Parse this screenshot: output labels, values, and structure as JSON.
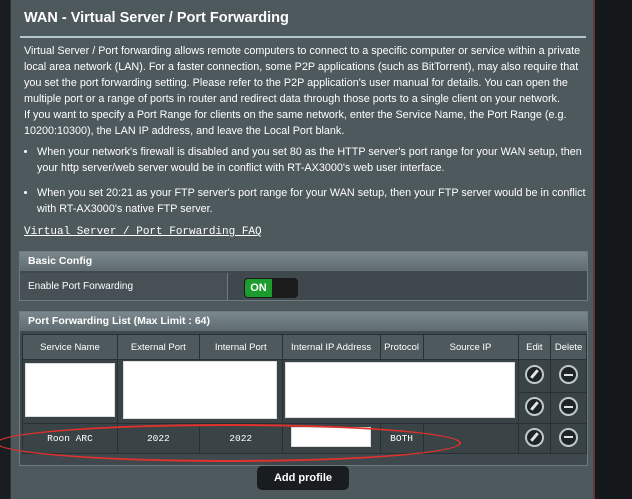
{
  "page": {
    "title": "WAN - Virtual Server / Port Forwarding",
    "description_1": "Virtual Server / Port forwarding allows remote computers to connect to a specific computer or service within a private local area network (LAN). For a faster connection, some P2P applications (such as BitTorrent), may also require that you set the port forwarding setting. Please refer to the P2P application's user manual for details. You can open the multiple port or a range of ports in router and redirect data through those ports to a single client on your network.",
    "description_2": "If you want to specify a Port Range for clients on the same network, enter the Service Name, the Port Range (e.g. 10200:10300), the LAN IP address, and leave the Local Port blank.",
    "bullet_1": "When your network's firewall is disabled and you set 80 as the HTTP server's port range for your WAN setup, then your http server/web server would be in conflict with RT-AX3000's web user interface.",
    "bullet_2": "When you set 20:21 as your FTP server's port range for your WAN setup, then your FTP server would be in conflict with RT-AX3000's native FTP server.",
    "faq_link": "Virtual Server / Port Forwarding FAQ"
  },
  "basic_config": {
    "header": "Basic Config",
    "enable_label": "Enable Port Forwarding",
    "toggle_state": "ON"
  },
  "port_forwarding": {
    "header": "Port Forwarding List (Max Limit : 64)",
    "columns": [
      "Service Name",
      "External Port",
      "Internal Port",
      "Internal IP Address",
      "Protocol",
      "Source IP",
      "Edit",
      "Delete"
    ],
    "rows": [
      {
        "service": "",
        "external": "",
        "internal": "",
        "ip": "",
        "protocol": "",
        "source": ""
      },
      {
        "service": "",
        "external": "",
        "internal": "",
        "ip": "",
        "protocol": "",
        "source": ""
      },
      {
        "service": "Roon ARC",
        "external": "2022",
        "internal": "2022",
        "ip": "",
        "protocol": "BOTH",
        "source": ""
      }
    ],
    "add_button": "Add profile"
  },
  "colors": {
    "toggle_on": "#1d9c2e",
    "highlight_ellipse": "#e0312c",
    "panel_bg": "#4d595d"
  }
}
